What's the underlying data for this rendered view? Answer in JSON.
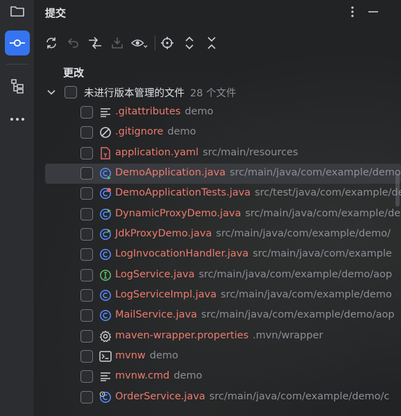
{
  "stripe": {
    "icons": [
      "folder-icon",
      "commit-icon",
      "structure-icon",
      "more-icon"
    ]
  },
  "header": {
    "title": "提交"
  },
  "toolbar": {
    "icons": [
      "refresh-icon",
      "rollback-icon",
      "compare-icon",
      "shelve-icon",
      "preview-icon",
      "locate-icon",
      "expand-all-icon",
      "collapse-all-icon"
    ]
  },
  "section": {
    "label": "更改"
  },
  "group": {
    "label": "未进行版本管理的文件",
    "count": "28 个文件"
  },
  "files": [
    {
      "name": ".gitattributes",
      "path": "demo",
      "icon": "text-file-icon"
    },
    {
      "name": ".gitignore",
      "path": "demo",
      "icon": "ignore-icon"
    },
    {
      "name": "application.yaml",
      "path": "src/main/resources",
      "icon": "yaml-icon"
    },
    {
      "name": "DemoApplication.java",
      "path": "src/main/java/com/example/demo",
      "icon": "spring-class-icon"
    },
    {
      "name": "DemoApplicationTests.java",
      "path": "src/test/java/com/example/demo",
      "icon": "test-class-icon"
    },
    {
      "name": "DynamicProxyDemo.java",
      "path": "src/main/java/com/example/demo",
      "icon": "runnable-class-icon"
    },
    {
      "name": "JdkProxyDemo.java",
      "path": "src/main/java/com/example/demo/",
      "icon": "runnable-class-icon"
    },
    {
      "name": "LogInvocationHandler.java",
      "path": "src/main/java/com/example",
      "icon": "class-icon"
    },
    {
      "name": "LogService.java",
      "path": "src/main/java/com/example/demo/aop",
      "icon": "interface-icon"
    },
    {
      "name": "LogServiceImpl.java",
      "path": "src/main/java/com/example/demo",
      "icon": "class-icon"
    },
    {
      "name": "MailService.java",
      "path": "src/main/java/com/example/demo/aop",
      "icon": "class-icon"
    },
    {
      "name": "maven-wrapper.properties",
      "path": ".mvn/wrapper",
      "icon": "gear-icon"
    },
    {
      "name": "mvnw",
      "path": "demo",
      "icon": "terminal-icon"
    },
    {
      "name": "mvnw.cmd",
      "path": "demo",
      "icon": "text-file-icon"
    },
    {
      "name": "OrderService.java",
      "path": "src/main/java/com/example/demo/c",
      "icon": "class-clock-icon"
    }
  ],
  "selected_index": 3,
  "colors": {
    "accent": "#3574f0",
    "unversioned_text": "#ec7b6f",
    "muted_text": "#8c8f95",
    "panel_bg": "#222325",
    "stripe_bg": "#2b2d30"
  }
}
